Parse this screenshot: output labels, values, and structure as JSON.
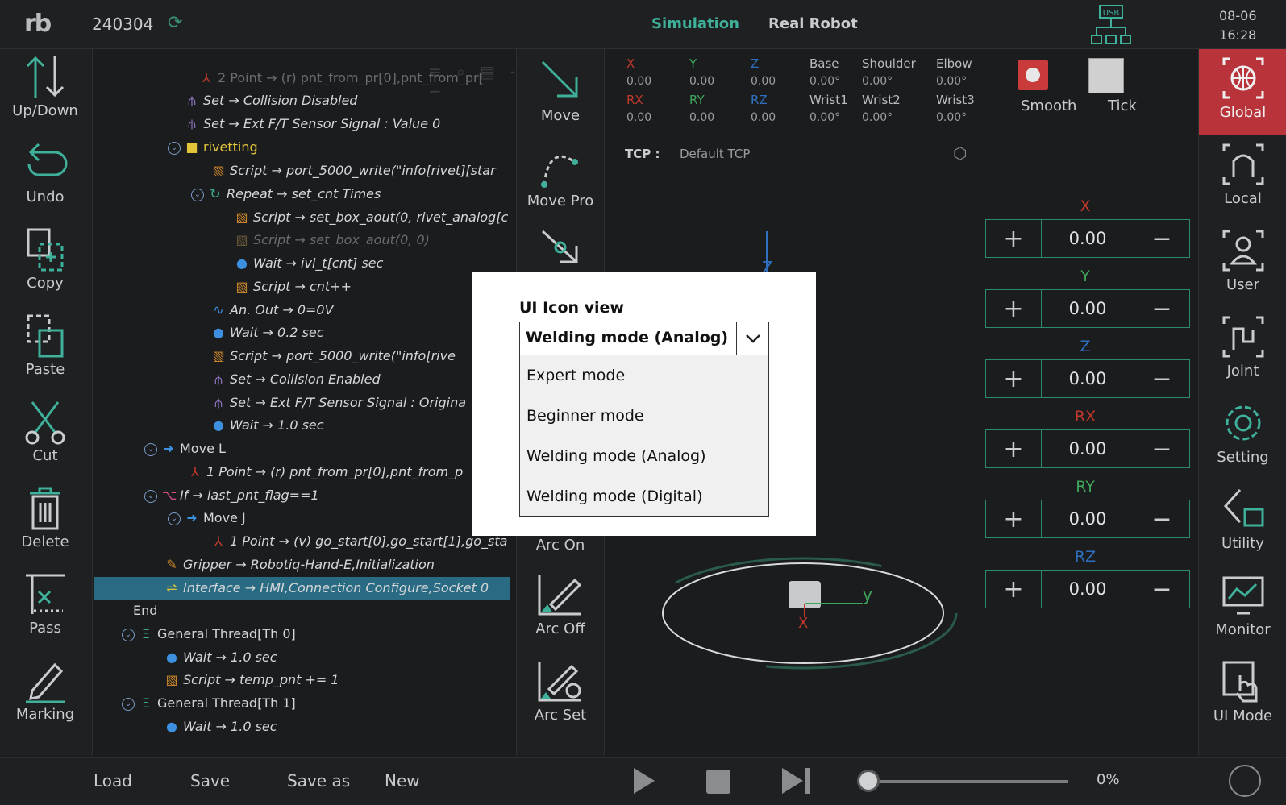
{
  "app": {
    "program_name": "240304",
    "mode_tabs": [
      "Simulation",
      "Real Robot"
    ],
    "usb_label": "USB",
    "date": "08-06",
    "time": "16:28"
  },
  "left_toolbar": [
    "Up/Down",
    "Undo",
    "Copy",
    "Paste",
    "Cut",
    "Delete",
    "Pass",
    "Marking"
  ],
  "tree": [
    {
      "text": "2 Point → (r) pnt_from_pr[0],pnt_from_pr[",
      "dim": true
    },
    {
      "text": "Set → Collision Disabled"
    },
    {
      "text": "Set → Ext F/T Sensor Signal : Value 0"
    },
    {
      "text": "rivetting"
    },
    {
      "text": "Script → port_5000_write(\"info[rivet][star"
    },
    {
      "text": "Repeat → set_cnt Times"
    },
    {
      "text": "Script → set_box_aout(0, rivet_analog[c"
    },
    {
      "text": "Script → set_box_aout(0, 0)",
      "dim": true
    },
    {
      "text": "Wait → ivl_t[cnt] sec"
    },
    {
      "text": "Script → cnt++"
    },
    {
      "text": "An. Out → 0=0V"
    },
    {
      "text": "Wait → 0.2 sec"
    },
    {
      "text": "Script → port_5000_write(\"info[rive"
    },
    {
      "text": "Set → Collision Enabled"
    },
    {
      "text": "Set → Ext F/T Sensor Signal : Origina"
    },
    {
      "text": "Wait → 1.0 sec"
    },
    {
      "text": "Move L"
    },
    {
      "text": "1 Point → (r) pnt_from_pr[0],pnt_from_p"
    },
    {
      "text": "If → last_pnt_flag==1"
    },
    {
      "text": "Move J"
    },
    {
      "text": "1 Point → (v) go_start[0],go_start[1],go_sta"
    },
    {
      "text": "Gripper → Robotiq-Hand-E,Initialization"
    },
    {
      "text": "Interface → HMI,Connection Configure,Socket 0",
      "selected": true
    },
    {
      "text": "End"
    },
    {
      "text": "General Thread[Th 0]"
    },
    {
      "text": "Wait → 1.0 sec"
    },
    {
      "text": "Script → temp_pnt += 1"
    },
    {
      "text": "General Thread[Th 1]"
    },
    {
      "text": "Wait → 1.0 sec"
    }
  ],
  "motion_toolbar": [
    "Move",
    "Move Pro",
    "Arc On",
    "Arc Off",
    "Arc Set"
  ],
  "readout": {
    "cart_labels": [
      "X",
      "Y",
      "Z",
      "RX",
      "RY",
      "RZ"
    ],
    "cart_values": [
      "0.00",
      "0.00",
      "0.00",
      "0.00",
      "0.00",
      "0.00"
    ],
    "joint_labels": [
      "Base",
      "Shoulder",
      "Elbow",
      "Wrist1",
      "Wrist2",
      "Wrist3"
    ],
    "joint_values": [
      "0.00°",
      "0.00°",
      "0.00°",
      "0.00°",
      "0.00°",
      "0.00°"
    ],
    "tcp_label": "TCP :",
    "tcp_value": "Default TCP",
    "smooth_label": "Smooth",
    "tick_label": "Tick"
  },
  "viewport_axes": {
    "z": "Z",
    "x": "X",
    "y": "y"
  },
  "jog": {
    "axes": [
      "X",
      "Y",
      "Z",
      "RX",
      "RY",
      "RZ"
    ],
    "values": [
      "0.00",
      "0.00",
      "0.00",
      "0.00",
      "0.00",
      "0.00"
    ],
    "colors": {
      "X": "#c0392b",
      "Y": "#3fa55a",
      "Z": "#2f6fc0",
      "RX": "#c0392b",
      "RY": "#3fa55a",
      "RZ": "#2f6fc0"
    }
  },
  "right_toolbar": [
    "Global",
    "Local",
    "User",
    "Joint",
    "Setting",
    "Utility",
    "Monitor",
    "UI Mode"
  ],
  "bottom": {
    "buttons": [
      "Load",
      "Save",
      "Save as",
      "New"
    ],
    "speed": "0%"
  },
  "modal": {
    "title": "UI Icon view",
    "selected": "Welding mode (Analog)",
    "options": [
      "Expert mode",
      "Beginner mode",
      "Welding mode (Analog)",
      "Welding mode (Digital)"
    ]
  },
  "colors": {
    "accent": "#3fb09a",
    "active": "#b8343a",
    "selected_row": "#2a6b84"
  }
}
